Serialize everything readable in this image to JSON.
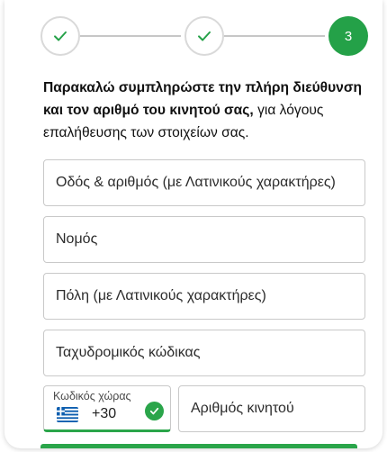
{
  "colors": {
    "accent": "#24a148",
    "border": "#c9c9c9",
    "step_done_border": "#d9d9d9",
    "text": "#111111"
  },
  "stepper": {
    "steps": [
      {
        "state": "done",
        "icon": "check-icon"
      },
      {
        "state": "done",
        "icon": "check-icon"
      },
      {
        "state": "current",
        "label": "3"
      }
    ]
  },
  "instruction": {
    "bold_text": "Παρακαλώ συμπληρώστε την πλήρη διεύθυνση και τον αριθμό του κινητού σας,",
    "regular_text": "για λόγους επαλήθευσης των στοιχείων σας."
  },
  "form": {
    "street_placeholder": "Οδός & αριθμός (με Λατινικούς χαρακτήρες)",
    "prefecture_placeholder": "Νομός",
    "city_placeholder": "Πόλη (με Λατινικούς χαρακτήρες)",
    "postal_code_placeholder": "Ταχυδρομικός κώδικας",
    "country_code": {
      "label": "Κωδικός χώρας",
      "value": "+30",
      "flag_icon": "greece-flag-icon",
      "status_icon": "check-circle-icon"
    },
    "mobile_placeholder": "Αριθμός κινητού"
  }
}
